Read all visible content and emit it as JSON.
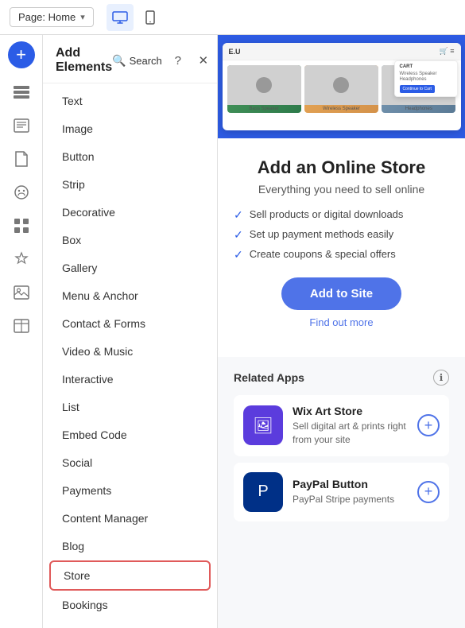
{
  "topbar": {
    "page_label": "Page: Home",
    "chevron": "▾"
  },
  "devices": [
    {
      "name": "desktop",
      "icon": "🖥",
      "active": true
    },
    {
      "name": "mobile",
      "icon": "📱",
      "active": false
    }
  ],
  "left_icons": [
    {
      "name": "add",
      "icon": "+"
    },
    {
      "name": "elements",
      "icon": "▬▬"
    },
    {
      "name": "blog",
      "icon": "≡"
    },
    {
      "name": "pages",
      "icon": "📄"
    },
    {
      "name": "design",
      "icon": "🎨"
    },
    {
      "name": "apps",
      "icon": "⊞"
    },
    {
      "name": "widgets",
      "icon": "✦"
    },
    {
      "name": "media",
      "icon": "🖼"
    },
    {
      "name": "tables",
      "icon": "⊟"
    }
  ],
  "panel": {
    "title": "Add Elements",
    "search_label": "Search",
    "help_label": "?",
    "close_label": "✕",
    "elements": [
      {
        "id": "text",
        "label": "Text"
      },
      {
        "id": "image",
        "label": "Image"
      },
      {
        "id": "button",
        "label": "Button"
      },
      {
        "id": "strip",
        "label": "Strip"
      },
      {
        "id": "decorative",
        "label": "Decorative"
      },
      {
        "id": "box",
        "label": "Box"
      },
      {
        "id": "gallery",
        "label": "Gallery"
      },
      {
        "id": "menu-anchor",
        "label": "Menu & Anchor"
      },
      {
        "id": "contact-forms",
        "label": "Contact & Forms"
      },
      {
        "id": "video-music",
        "label": "Video & Music"
      },
      {
        "id": "interactive",
        "label": "Interactive"
      },
      {
        "id": "list",
        "label": "List"
      },
      {
        "id": "embed-code",
        "label": "Embed Code"
      },
      {
        "id": "social",
        "label": "Social"
      },
      {
        "id": "payments",
        "label": "Payments"
      },
      {
        "id": "content-manager",
        "label": "Content Manager"
      },
      {
        "id": "blog",
        "label": "Blog"
      },
      {
        "id": "store",
        "label": "Store",
        "selected": true
      },
      {
        "id": "bookings",
        "label": "Bookings"
      }
    ]
  },
  "store_feature": {
    "title": "Add an Online Store",
    "subtitle": "Everything you need to sell online",
    "features": [
      "Sell products or digital downloads",
      "Set up payment methods easily",
      "Create coupons & special offers"
    ],
    "add_btn": "Add to Site",
    "find_more": "Find out more",
    "mockup": {
      "logo": "E.U",
      "cart": "🛒≡"
    }
  },
  "related_apps": {
    "title": "Related Apps",
    "apps": [
      {
        "id": "wix-art-store",
        "name": "Wix Art Store",
        "desc": "Sell digital art & prints right from your site",
        "icon": "🖼",
        "icon_bg": "wix"
      },
      {
        "id": "paypal-button",
        "name": "PayPal Button",
        "desc": "PayPal Stripe payments",
        "icon": "P",
        "icon_bg": "paypal"
      }
    ]
  }
}
